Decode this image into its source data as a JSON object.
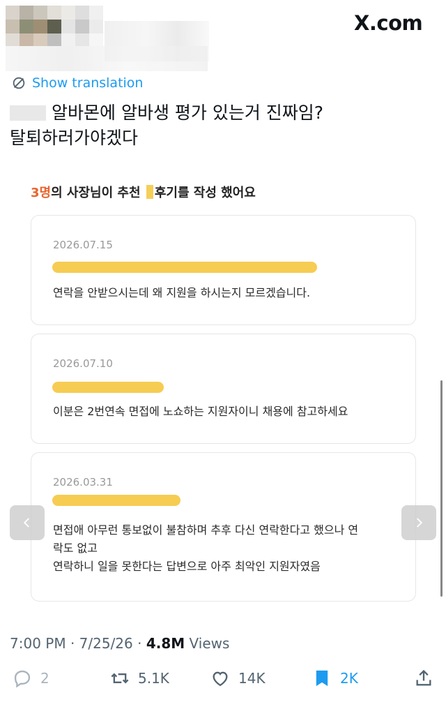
{
  "header": {
    "logo_text": "X.com"
  },
  "tweet": {
    "translate_label": "Show translation",
    "text_line1": "알바몬에 알바생 평가 있는거 진짜임?",
    "text_line2": "탈퇴하러가야겠다"
  },
  "embedded": {
    "title_count": "3명",
    "title_part1": "의 사장님이 추천",
    "title_part2": "후기를 작성 했어요",
    "reviews": [
      {
        "date": "2026.07.15",
        "text": "연락을 안받으시는데 왜 지원을 하시는지 모르겠습니다."
      },
      {
        "date": "2026.07.10",
        "text": "이분은 2번연속 면접에 노쇼하는 지원자이니 채용에 참고하세요"
      },
      {
        "date": "2026.03.31",
        "text_line1": "면접애 아무런 통보없이 불참하며 추후 다신 연락한다고 했으나 연",
        "text_line2": "락도 없고",
        "text_line3": "연락하니 일을 못한다는 답변으로 아주 최악인 지원자였음"
      }
    ]
  },
  "meta": {
    "timestamp": "7:00 PM · 7/25/26 · ",
    "views_count": "4.8M",
    "views_label": " Views"
  },
  "actions": {
    "reply_count": "2",
    "retweet_count": "5.1K",
    "like_count": "14K",
    "bookmark_count": "2K"
  },
  "colors": {
    "accent": "#1d9bf0",
    "highlight": "#f6cc52",
    "count_orange": "#e8652e",
    "muted": "#536471"
  }
}
